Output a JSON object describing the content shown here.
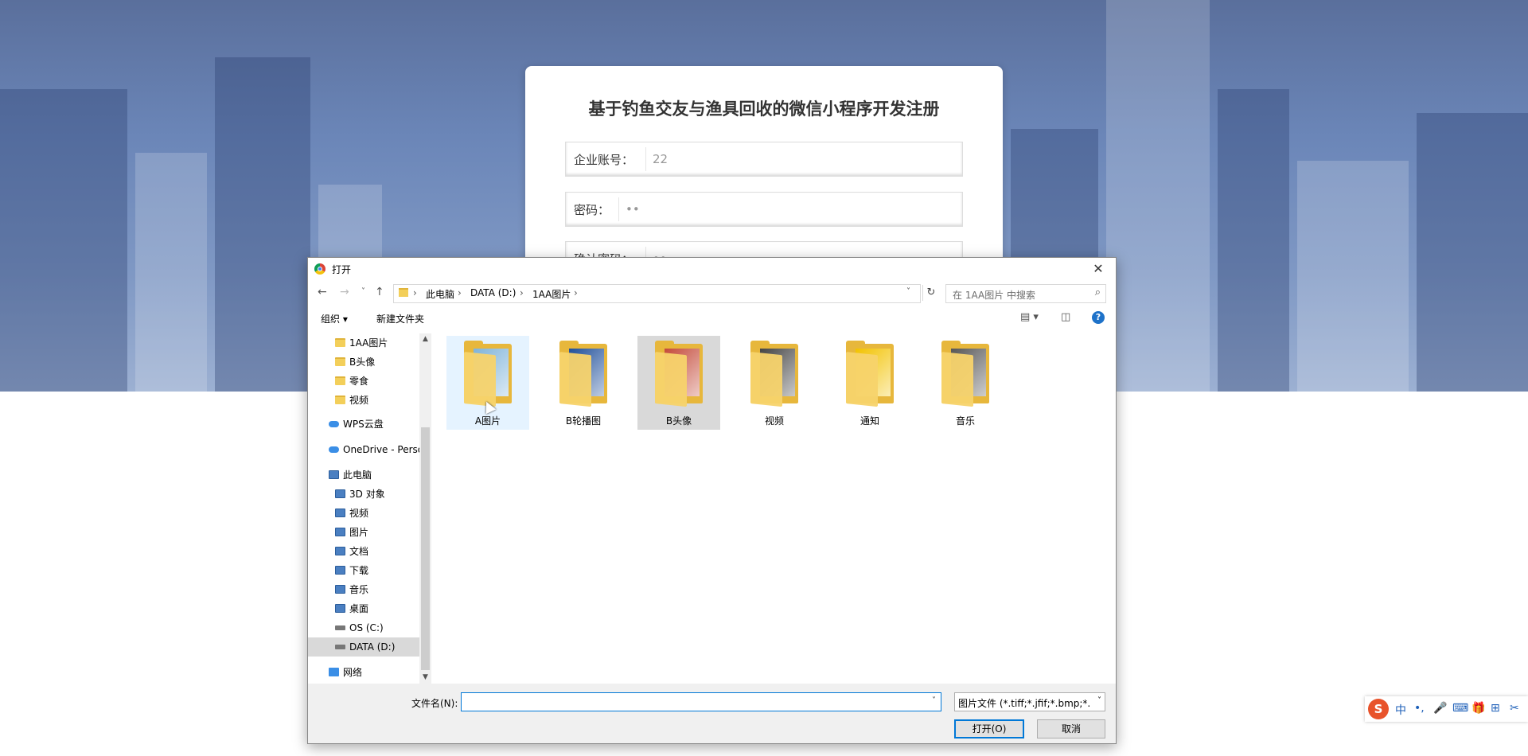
{
  "register": {
    "title": "基于钓鱼交友与渔具回收的微信小程序开发注册",
    "account_label": "企业账号：",
    "account_value": "22",
    "password_label": "密码：",
    "password_value": "••",
    "confirm_label": "确认密码：",
    "confirm_value": "••"
  },
  "dialog": {
    "title": "打开",
    "close": "✕",
    "back": "←",
    "forward": "→",
    "recent": "˅",
    "up": "↑",
    "breadcrumbs": [
      "此电脑",
      "DATA (D:)",
      "1AA图片"
    ],
    "refresh": "↻",
    "search_placeholder": "在 1AA图片 中搜索",
    "toolbar": {
      "organize": "组织 ▾",
      "new_folder": "新建文件夹",
      "view": "▤ ▾",
      "preview_pane": "◫",
      "help": "?"
    },
    "nav": [
      {
        "label": "1AA图片",
        "icon": "folder-icon",
        "indent": 1
      },
      {
        "label": "B头像",
        "icon": "folder-icon",
        "indent": 1
      },
      {
        "label": "零食",
        "icon": "folder-icon",
        "indent": 1
      },
      {
        "label": "视频",
        "icon": "folder-icon",
        "indent": 1
      },
      {
        "label": "WPS云盘",
        "icon": "cloud-icon",
        "indent": 0
      },
      {
        "label": "OneDrive - Personal",
        "icon": "onedrive-icon",
        "indent": 0
      },
      {
        "label": "此电脑",
        "icon": "pc-icon",
        "indent": 0
      },
      {
        "label": "3D 对象",
        "icon": "3d-objects-icon",
        "indent": 1
      },
      {
        "label": "视频",
        "icon": "video-icon",
        "indent": 1
      },
      {
        "label": "图片",
        "icon": "pictures-icon",
        "indent": 1
      },
      {
        "label": "文档",
        "icon": "documents-icon",
        "indent": 1
      },
      {
        "label": "下载",
        "icon": "download-icon",
        "indent": 1
      },
      {
        "label": "音乐",
        "icon": "music-icon",
        "indent": 1
      },
      {
        "label": "桌面",
        "icon": "desktop-icon",
        "indent": 1
      },
      {
        "label": "OS (C:)",
        "icon": "drive-icon",
        "indent": 1
      },
      {
        "label": "DATA (D:)",
        "icon": "drive-icon",
        "indent": 1,
        "selected": true
      },
      {
        "label": "网络",
        "icon": "network-icon",
        "indent": 0
      }
    ],
    "files": [
      {
        "name": "A图片",
        "state": "hover",
        "thumb": "#7fb3d9"
      },
      {
        "name": "B轮播图",
        "state": "",
        "thumb": "#1f4f9a"
      },
      {
        "name": "B头像",
        "state": "selected",
        "thumb": "#c44a3a"
      },
      {
        "name": "视频",
        "state": "",
        "thumb": "#444444"
      },
      {
        "name": "通知",
        "state": "",
        "thumb": "#f2c200"
      },
      {
        "name": "音乐",
        "state": "",
        "thumb": "#555555"
      }
    ],
    "filename_label": "文件名(N):",
    "filename_value": "",
    "filter": "图片文件 (*.tiff;*.jfif;*.bmp;*.gif",
    "open_button": "打开(O)",
    "cancel_button": "取消"
  },
  "ime": {
    "logo": "S",
    "items": [
      "中",
      "•,",
      "🎤",
      "⌨",
      "🎁",
      "⊞",
      "✂"
    ]
  }
}
